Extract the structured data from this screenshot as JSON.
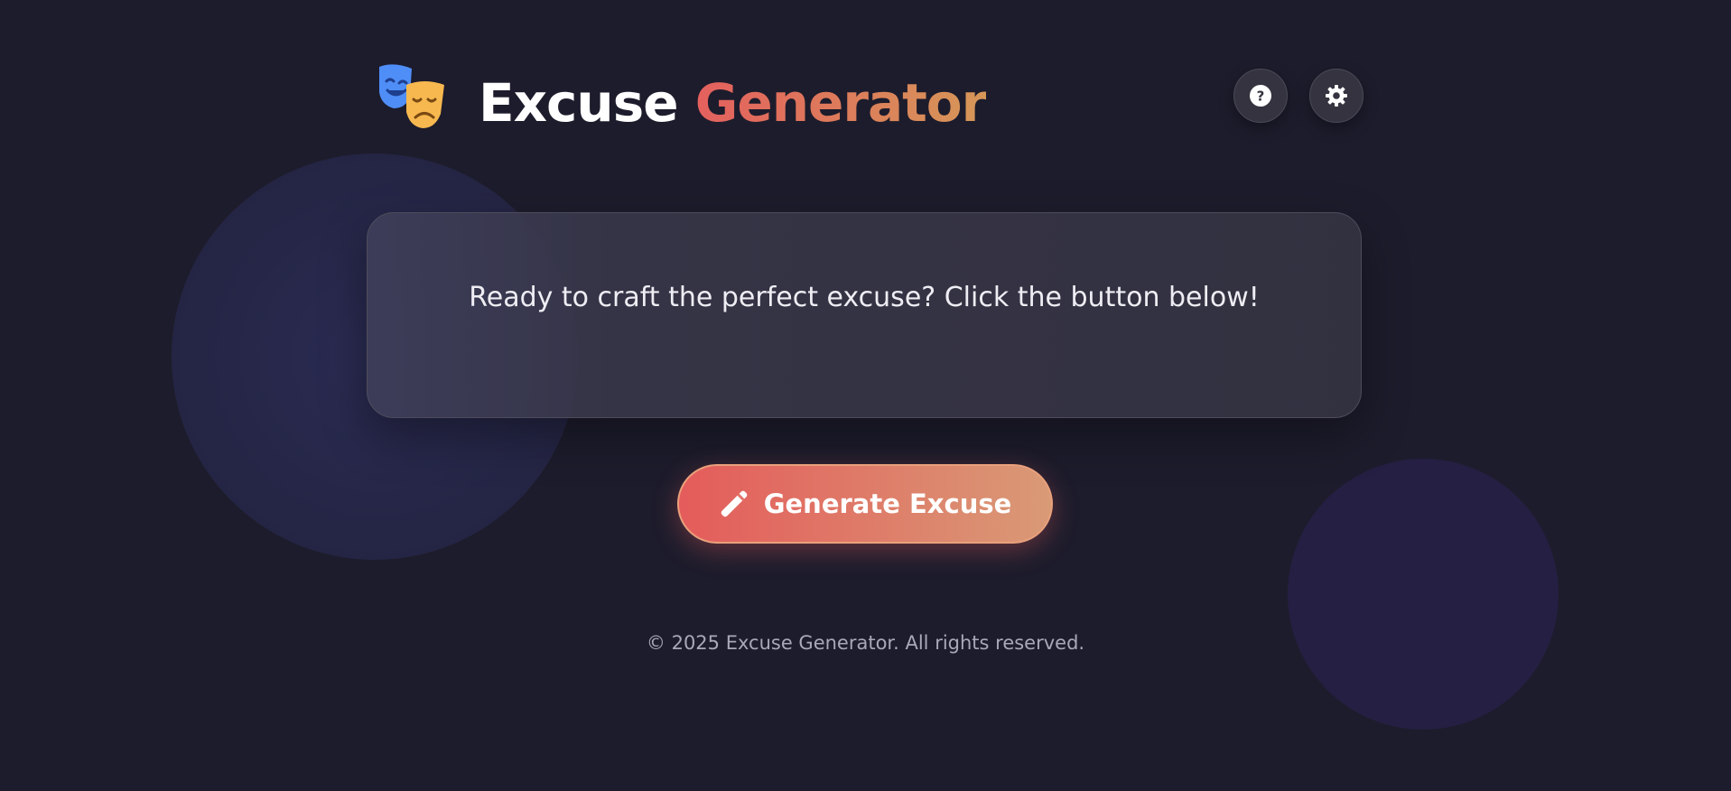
{
  "header": {
    "title_part1": "Excuse",
    "title_part2": "Generator",
    "logo_icon": "theater-masks-icon",
    "help_icon": "question-circle-icon",
    "settings_icon": "gear-icon"
  },
  "card": {
    "message": "Ready to craft the perfect excuse? Click the button below!"
  },
  "generate_button": {
    "label": "Generate Excuse",
    "icon": "magic-wand-icon"
  },
  "footer": {
    "text": "© 2025 Excuse Generator. All rights reserved."
  },
  "colors": {
    "background": "#1d1c2c",
    "accent_start": "#e4605e",
    "accent_end": "#d69758"
  }
}
